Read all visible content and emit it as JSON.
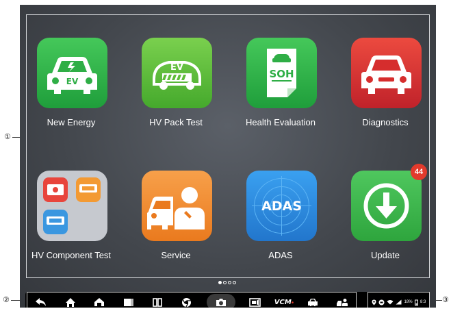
{
  "callouts": [
    "①",
    "②",
    "③"
  ],
  "apps": [
    {
      "label": "New Energy",
      "icon": "ev-car-icon",
      "color": "#2fb34a"
    },
    {
      "label": "HV Pack Test",
      "icon": "ev-battery-pack-icon",
      "color": "#5fbd3a",
      "icon_text": "EV"
    },
    {
      "label": "Health Evaluation",
      "icon": "soh-report-icon",
      "color": "#2fb34a",
      "icon_text": "SOH"
    },
    {
      "label": "Diagnostics",
      "icon": "car-front-icon",
      "color": "#d62d2d"
    },
    {
      "label": "HV Component Test",
      "icon": "folder-icon",
      "color": "#c9ccd2"
    },
    {
      "label": "Service",
      "icon": "car-mechanic-icon",
      "color": "#f08a2e"
    },
    {
      "label": "ADAS",
      "icon": "adas-radar-icon",
      "color": "#2f8ee0",
      "icon_text": "ADAS"
    },
    {
      "label": "Update",
      "icon": "download-arrow-icon",
      "color": "#3bb54a",
      "badge": "44"
    }
  ],
  "page_indicator": {
    "pages": 4,
    "current": 1
  },
  "nav_bar": {
    "buttons": [
      "back-icon",
      "home-icon",
      "autel-home-icon",
      "desktop-icon",
      "recent-apps-icon",
      "chrome-icon",
      "camera-icon",
      "screen-record-icon",
      "vcm-icon",
      "car-icon",
      "car-service-icon"
    ],
    "vcm_label": "VCM",
    "selected": "camera-icon"
  },
  "status_bar": {
    "icons": [
      "location-icon",
      "vci-icon",
      "wifi-icon",
      "network-icon",
      "battery-icon"
    ],
    "battery_text": "18%",
    "time_text": "8:3"
  },
  "colors": {
    "screen_bg": "#43474d",
    "badge": "#e23a2c",
    "nav_bg": "#000000"
  }
}
